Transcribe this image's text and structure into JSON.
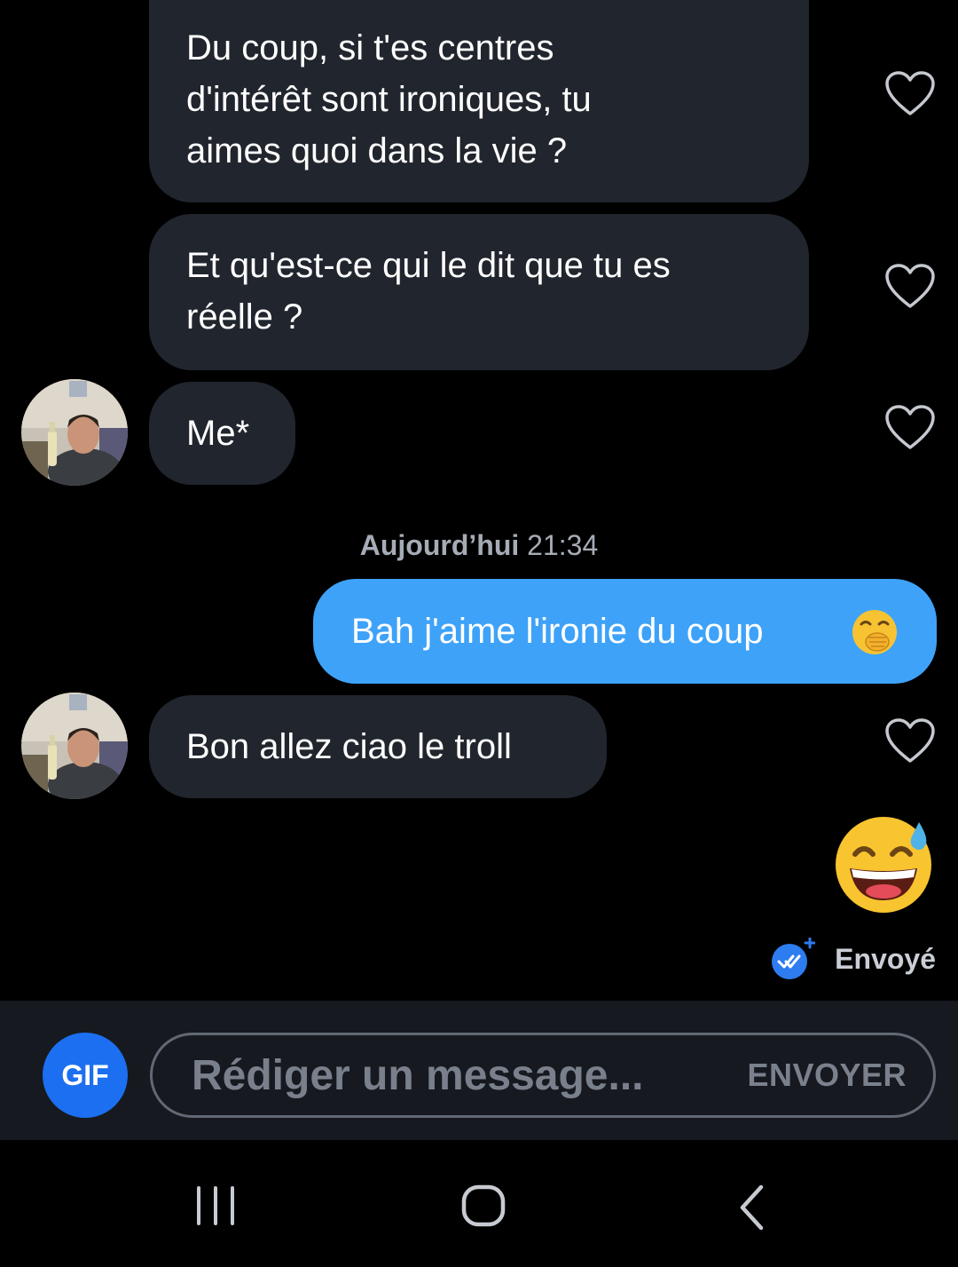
{
  "messages": [
    {
      "text": "Du coup, si t'es centres\nd'intérêt sont ironiques, tu\naimes quoi dans la vie ?"
    },
    {
      "text": "Et qu'est-ce qui le dit que tu es\nréelle ?"
    },
    {
      "text": "Me*"
    },
    {
      "text": "Bah j'aime l'ironie du coup"
    },
    {
      "text": "Bon allez ciao le troll"
    }
  ],
  "timestamp": {
    "day": "Aujourd’hui",
    "time": "21:34"
  },
  "sent_status": "Envoyé",
  "composer": {
    "gif_label": "GIF",
    "placeholder": "Rédiger un message...",
    "send_label": "ENVOYER"
  },
  "colors": {
    "incoming_bubble": "#21252d",
    "outgoing_bubble": "#3ea2f8",
    "gif_button": "#1c6ff0",
    "background": "#000000"
  },
  "icons": {
    "like": "heart-outline-icon",
    "reaction_emoji": "grinning-sweat-emoji",
    "inline_emoji": "face-with-hand-over-mouth-emoji",
    "read_receipt": "double-check-icon"
  }
}
